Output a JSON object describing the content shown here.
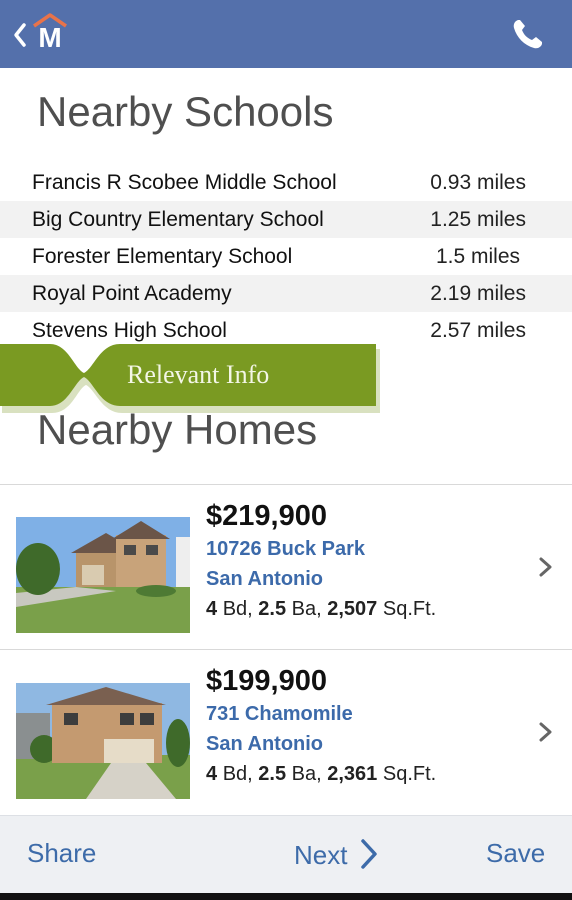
{
  "header": {
    "logo_letter": "M"
  },
  "schools": {
    "title": "Nearby Schools",
    "rows": [
      {
        "name": "Francis R Scobee Middle School",
        "distance": "0.93 miles"
      },
      {
        "name": "Big Country Elementary School",
        "distance": "1.25 miles"
      },
      {
        "name": "Forester Elementary School",
        "distance": "1.5 miles"
      },
      {
        "name": "Royal Point Academy",
        "distance": "2.19 miles"
      },
      {
        "name": "Stevens High School",
        "distance": "2.57 miles"
      }
    ]
  },
  "ribbon": {
    "label": "Relevant Info",
    "color": "#7a9a22"
  },
  "homes": {
    "title": "Nearby Homes",
    "items": [
      {
        "price": "$219,900",
        "street": "10726 Buck Park",
        "city": "San Antonio",
        "beds": "4",
        "beds_label": "Bd,",
        "baths": "2.5",
        "baths_label": "Ba,",
        "sqft": "2,507",
        "sqft_label": "Sq.Ft."
      },
      {
        "price": "$199,900",
        "street": "731 Chamomile",
        "city": "San Antonio",
        "beds": "4",
        "beds_label": "Bd,",
        "baths": "2.5",
        "baths_label": "Ba,",
        "sqft": "2,361",
        "sqft_label": "Sq.Ft."
      }
    ]
  },
  "bottom_bar": {
    "share": "Share",
    "next": "Next",
    "save": "Save"
  },
  "colors": {
    "header_bg": "#5470ab",
    "link": "#3c6aaa",
    "ribbon": "#7a9a22"
  }
}
